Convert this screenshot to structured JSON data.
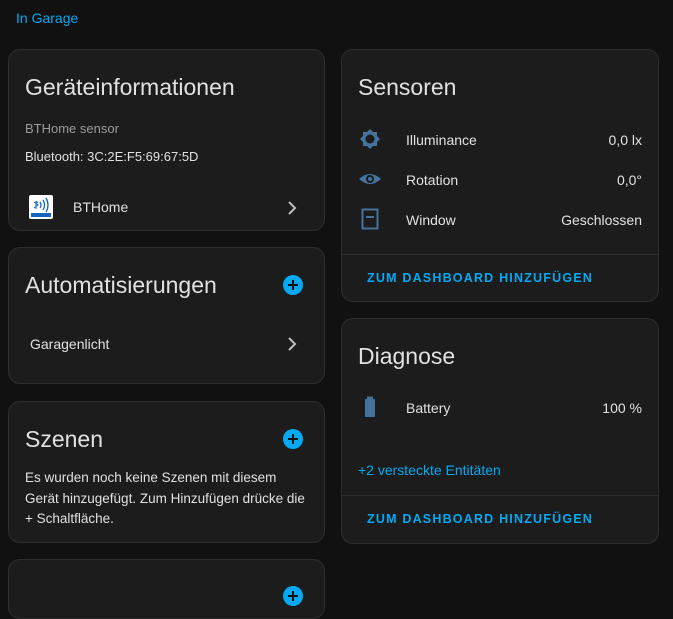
{
  "area_link": "In Garage",
  "device_info": {
    "title": "Geräteinformationen",
    "model": "BTHome sensor",
    "connection": "Bluetooth: 3C:2E:F5:69:67:5D",
    "integration_label": "BTHome"
  },
  "automations": {
    "title": "Automatisierungen",
    "items": [
      "Garagenlicht"
    ]
  },
  "scenes": {
    "title": "Szenen",
    "empty_text": "Es wurden noch keine Szenen mit diesem Gerät hinzugefügt. Zum Hinzufügen drücke die + Schaltfläche."
  },
  "sensors": {
    "title": "Sensoren",
    "rows": [
      {
        "icon": "brightness-icon",
        "label": "Illuminance",
        "value": "0,0 lx"
      },
      {
        "icon": "eye-icon",
        "label": "Rotation",
        "value": "0,0°"
      },
      {
        "icon": "window-icon",
        "label": "Window",
        "value": "Geschlossen"
      }
    ],
    "add_dashboard": "ZUM DASHBOARD HINZUFÜGEN"
  },
  "diagnostics": {
    "title": "Diagnose",
    "rows": [
      {
        "icon": "battery-icon",
        "label": "Battery",
        "value": "100 %"
      }
    ],
    "hidden_entities": "+2 versteckte Entitäten",
    "add_dashboard": "ZUM DASHBOARD HINZUFÜGEN"
  },
  "colors": {
    "accent": "#03a9f4",
    "card_bg": "#1c1c1c",
    "page_bg": "#111111",
    "icon": "#44739e"
  }
}
